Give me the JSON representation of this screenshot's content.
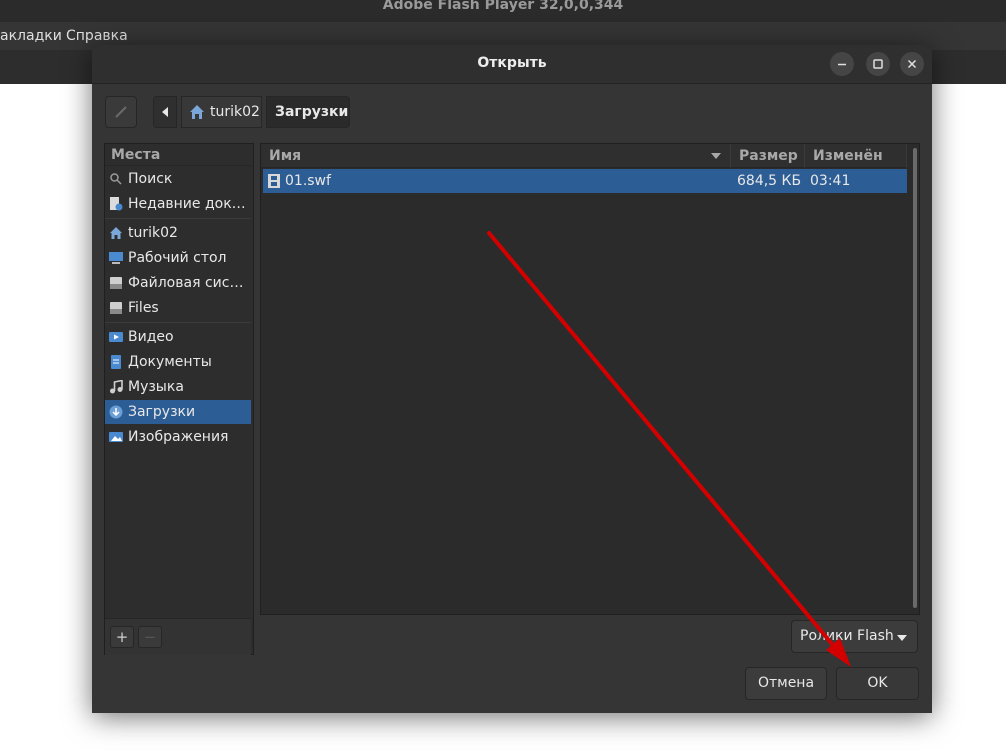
{
  "background_window": {
    "title": "Adobe Flash Player 32,0,0,344",
    "menu": [
      "акладки",
      "Справка"
    ]
  },
  "dialog": {
    "title": "Открыть",
    "window_controls": [
      "minimize-icon",
      "maximize-icon",
      "close-icon"
    ]
  },
  "pathbar": {
    "edit_icon": "pencil-icon",
    "back_icon": "chevron-left-icon",
    "crumbs": [
      {
        "label": "turik02",
        "icon": "home-icon"
      },
      {
        "label": "Загрузки"
      }
    ]
  },
  "sidebar": {
    "heading": "Места",
    "items": [
      {
        "label": "Поиск",
        "icon": "search-icon"
      },
      {
        "label": "Недавние документы",
        "icon": "recent-documents-icon"
      },
      {
        "label": "turik02",
        "icon": "home-icon"
      },
      {
        "label": "Рабочий стол",
        "icon": "desktop-icon"
      },
      {
        "label": "Файловая система",
        "icon": "drive-icon"
      },
      {
        "label": "Files",
        "icon": "drive-icon"
      },
      {
        "label": "Видео",
        "icon": "video-folder-icon"
      },
      {
        "label": "Документы",
        "icon": "documents-folder-icon"
      },
      {
        "label": "Музыка",
        "icon": "music-icon"
      },
      {
        "label": "Загрузки",
        "icon": "downloads-icon",
        "selected": true
      },
      {
        "label": "Изображения",
        "icon": "pictures-icon"
      }
    ],
    "add_label": "+",
    "remove_label": "−"
  },
  "filelist": {
    "columns": [
      "Имя",
      "Размер",
      "Изменён"
    ],
    "sort_icon": "sort-down-icon",
    "rows": [
      {
        "name": "01.swf",
        "size": "684,5 КБ",
        "modified": "03:41",
        "icon": "film-icon",
        "selected": true
      }
    ]
  },
  "filter": {
    "label": "Ролики Flash",
    "icon": "dropdown-arrow-icon"
  },
  "buttons": {
    "cancel": "Отмена",
    "ok": "OK"
  },
  "colors": {
    "selection": "#2c5d94",
    "dialog_bg": "#353535",
    "annotation_arrow": "#d40000"
  }
}
